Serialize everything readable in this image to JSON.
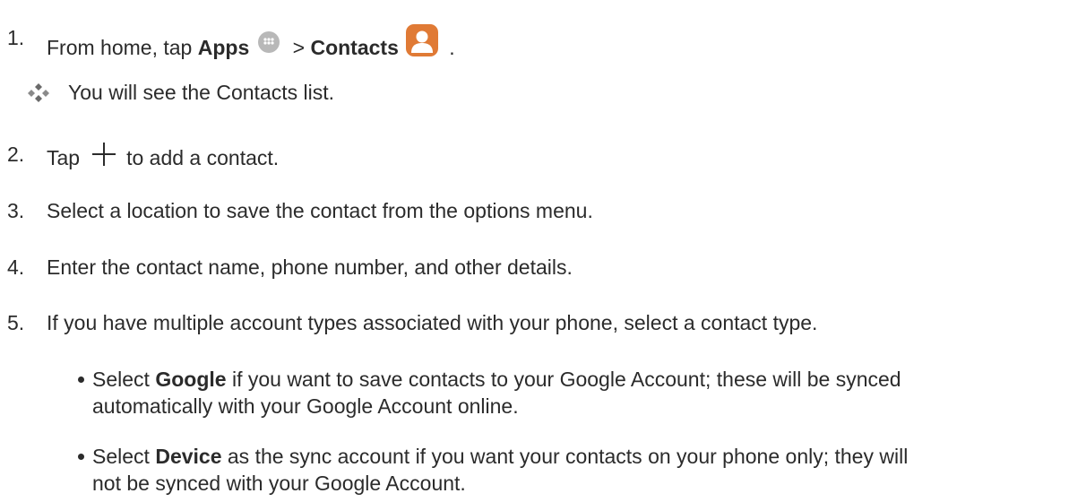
{
  "steps": [
    {
      "num": "1.",
      "prefix": "From home, tap ",
      "apps": "Apps",
      "sep": " > ",
      "contacts": "Contacts",
      "suffix": " ."
    },
    {
      "num": "2.",
      "prefix": "Tap",
      "suffix": "to add a contact."
    },
    {
      "num": "3.",
      "text": "Select a location to save the contact from the options menu."
    },
    {
      "num": "4.",
      "text": "Enter the contact name, phone number, and other details."
    },
    {
      "num": "5.",
      "text": "If you have multiple account types associated with your phone, select a contact type."
    }
  ],
  "result_note": "You will see the Contacts list.",
  "bullets": [
    {
      "pre": "Select ",
      "bold": "Google",
      "line1": " if you want to save contacts to your Google Account; these will be synced",
      "line2": "automatically with your Google Account online."
    },
    {
      "pre": "Select ",
      "bold": "Device",
      "line1": " as the sync account if you want your contacts on your phone only; they will",
      "line2": "not be synced with your Google Account."
    }
  ],
  "icons": {
    "apps": "apps-grid-icon",
    "contacts": "contacts-person-icon",
    "add": "plus-icon",
    "result": "diamond-bullet-icon"
  },
  "colors": {
    "text": "#2b2b2b",
    "apps_icon": "#b8b8b8",
    "contacts_icon": "#e07a35"
  }
}
